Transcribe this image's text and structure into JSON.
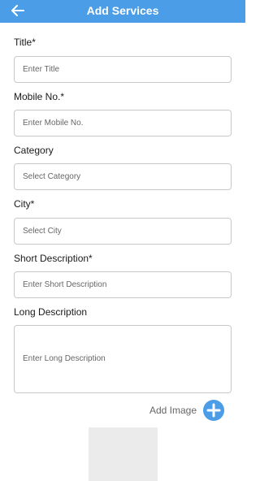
{
  "header": {
    "title": "Add Services",
    "back_icon": "arrow-left-icon"
  },
  "form": {
    "title": {
      "label": "Title*",
      "placeholder": "Enter Title"
    },
    "mobile": {
      "label": "Mobile No.*",
      "placeholder": "Enter Mobile No."
    },
    "category": {
      "label": "Category",
      "placeholder": "Select Category"
    },
    "city": {
      "label": "City*",
      "placeholder": "Select City"
    },
    "short_description": {
      "label": "Short Description*",
      "placeholder": "Enter Short Description"
    },
    "long_description": {
      "label": "Long Description",
      "placeholder": "Enter Long Description"
    }
  },
  "image": {
    "add_label": "Add Image",
    "add_icon": "plus-circle-icon"
  },
  "colors": {
    "appbar": "#4a9de6",
    "accent": "#4a9de6",
    "border": "#c9c9c9"
  }
}
